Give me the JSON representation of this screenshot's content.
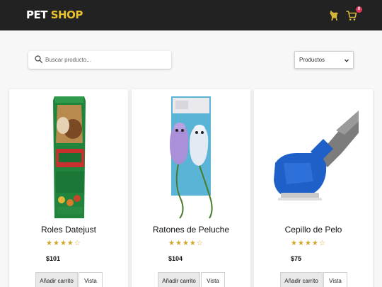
{
  "header": {
    "brand_part1": "PET",
    "brand_part2": "SHOP",
    "paw_icon": "paw-icon",
    "cart_icon": "cart-icon",
    "cart_count": "0",
    "brand_accent_color": "#e8c12f",
    "badge_color": "#e23b5a"
  },
  "search": {
    "placeholder": "Buscar producto..."
  },
  "filter": {
    "selected": "Productos"
  },
  "products": [
    {
      "name": "Roles Datejust",
      "rating": 4,
      "max_rating": 5,
      "price": "$101",
      "add_label": "Añadir carrito",
      "view_label": "Vista"
    },
    {
      "name": "Ratones de Peluche",
      "rating": 4,
      "max_rating": 5,
      "price": "$104",
      "add_label": "Añadir carrito",
      "view_label": "Vista"
    },
    {
      "name": "Cepillo de Pelo",
      "rating": 4,
      "max_rating": 5,
      "price": "$75",
      "add_label": "Añadir carrito",
      "view_label": "Vista"
    }
  ]
}
